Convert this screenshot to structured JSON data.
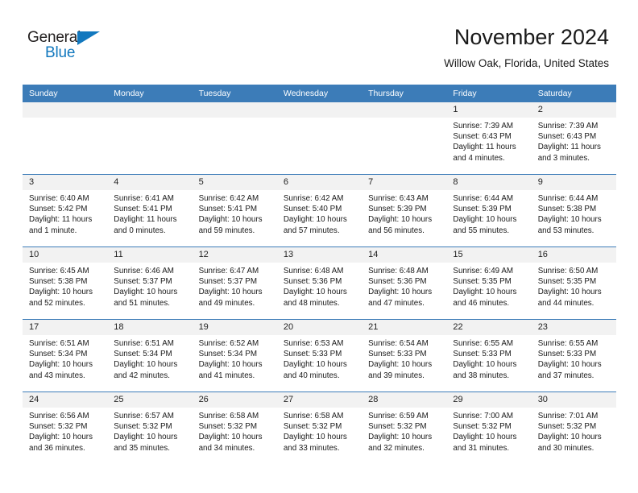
{
  "brand": {
    "name_part1": "General",
    "name_part2": "Blue",
    "accent_color": "#1278be",
    "logo_icon": "triangle-icon"
  },
  "header": {
    "title": "November 2024",
    "subtitle": "Willow Oak, Florida, United States"
  },
  "calendar": {
    "header_bg": "#3c7cb8",
    "daynum_bg": "#f2f2f2",
    "weekdays": [
      "Sunday",
      "Monday",
      "Tuesday",
      "Wednesday",
      "Thursday",
      "Friday",
      "Saturday"
    ],
    "weeks": [
      [
        {
          "day": "",
          "empty": true
        },
        {
          "day": "",
          "empty": true
        },
        {
          "day": "",
          "empty": true
        },
        {
          "day": "",
          "empty": true
        },
        {
          "day": "",
          "empty": true
        },
        {
          "day": "1",
          "sunrise": "Sunrise: 7:39 AM",
          "sunset": "Sunset: 6:43 PM",
          "daylight1": "Daylight: 11 hours",
          "daylight2": "and 4 minutes."
        },
        {
          "day": "2",
          "sunrise": "Sunrise: 7:39 AM",
          "sunset": "Sunset: 6:43 PM",
          "daylight1": "Daylight: 11 hours",
          "daylight2": "and 3 minutes."
        }
      ],
      [
        {
          "day": "3",
          "sunrise": "Sunrise: 6:40 AM",
          "sunset": "Sunset: 5:42 PM",
          "daylight1": "Daylight: 11 hours",
          "daylight2": "and 1 minute."
        },
        {
          "day": "4",
          "sunrise": "Sunrise: 6:41 AM",
          "sunset": "Sunset: 5:41 PM",
          "daylight1": "Daylight: 11 hours",
          "daylight2": "and 0 minutes."
        },
        {
          "day": "5",
          "sunrise": "Sunrise: 6:42 AM",
          "sunset": "Sunset: 5:41 PM",
          "daylight1": "Daylight: 10 hours",
          "daylight2": "and 59 minutes."
        },
        {
          "day": "6",
          "sunrise": "Sunrise: 6:42 AM",
          "sunset": "Sunset: 5:40 PM",
          "daylight1": "Daylight: 10 hours",
          "daylight2": "and 57 minutes."
        },
        {
          "day": "7",
          "sunrise": "Sunrise: 6:43 AM",
          "sunset": "Sunset: 5:39 PM",
          "daylight1": "Daylight: 10 hours",
          "daylight2": "and 56 minutes."
        },
        {
          "day": "8",
          "sunrise": "Sunrise: 6:44 AM",
          "sunset": "Sunset: 5:39 PM",
          "daylight1": "Daylight: 10 hours",
          "daylight2": "and 55 minutes."
        },
        {
          "day": "9",
          "sunrise": "Sunrise: 6:44 AM",
          "sunset": "Sunset: 5:38 PM",
          "daylight1": "Daylight: 10 hours",
          "daylight2": "and 53 minutes."
        }
      ],
      [
        {
          "day": "10",
          "sunrise": "Sunrise: 6:45 AM",
          "sunset": "Sunset: 5:38 PM",
          "daylight1": "Daylight: 10 hours",
          "daylight2": "and 52 minutes."
        },
        {
          "day": "11",
          "sunrise": "Sunrise: 6:46 AM",
          "sunset": "Sunset: 5:37 PM",
          "daylight1": "Daylight: 10 hours",
          "daylight2": "and 51 minutes."
        },
        {
          "day": "12",
          "sunrise": "Sunrise: 6:47 AM",
          "sunset": "Sunset: 5:37 PM",
          "daylight1": "Daylight: 10 hours",
          "daylight2": "and 49 minutes."
        },
        {
          "day": "13",
          "sunrise": "Sunrise: 6:48 AM",
          "sunset": "Sunset: 5:36 PM",
          "daylight1": "Daylight: 10 hours",
          "daylight2": "and 48 minutes."
        },
        {
          "day": "14",
          "sunrise": "Sunrise: 6:48 AM",
          "sunset": "Sunset: 5:36 PM",
          "daylight1": "Daylight: 10 hours",
          "daylight2": "and 47 minutes."
        },
        {
          "day": "15",
          "sunrise": "Sunrise: 6:49 AM",
          "sunset": "Sunset: 5:35 PM",
          "daylight1": "Daylight: 10 hours",
          "daylight2": "and 46 minutes."
        },
        {
          "day": "16",
          "sunrise": "Sunrise: 6:50 AM",
          "sunset": "Sunset: 5:35 PM",
          "daylight1": "Daylight: 10 hours",
          "daylight2": "and 44 minutes."
        }
      ],
      [
        {
          "day": "17",
          "sunrise": "Sunrise: 6:51 AM",
          "sunset": "Sunset: 5:34 PM",
          "daylight1": "Daylight: 10 hours",
          "daylight2": "and 43 minutes."
        },
        {
          "day": "18",
          "sunrise": "Sunrise: 6:51 AM",
          "sunset": "Sunset: 5:34 PM",
          "daylight1": "Daylight: 10 hours",
          "daylight2": "and 42 minutes."
        },
        {
          "day": "19",
          "sunrise": "Sunrise: 6:52 AM",
          "sunset": "Sunset: 5:34 PM",
          "daylight1": "Daylight: 10 hours",
          "daylight2": "and 41 minutes."
        },
        {
          "day": "20",
          "sunrise": "Sunrise: 6:53 AM",
          "sunset": "Sunset: 5:33 PM",
          "daylight1": "Daylight: 10 hours",
          "daylight2": "and 40 minutes."
        },
        {
          "day": "21",
          "sunrise": "Sunrise: 6:54 AM",
          "sunset": "Sunset: 5:33 PM",
          "daylight1": "Daylight: 10 hours",
          "daylight2": "and 39 minutes."
        },
        {
          "day": "22",
          "sunrise": "Sunrise: 6:55 AM",
          "sunset": "Sunset: 5:33 PM",
          "daylight1": "Daylight: 10 hours",
          "daylight2": "and 38 minutes."
        },
        {
          "day": "23",
          "sunrise": "Sunrise: 6:55 AM",
          "sunset": "Sunset: 5:33 PM",
          "daylight1": "Daylight: 10 hours",
          "daylight2": "and 37 minutes."
        }
      ],
      [
        {
          "day": "24",
          "sunrise": "Sunrise: 6:56 AM",
          "sunset": "Sunset: 5:32 PM",
          "daylight1": "Daylight: 10 hours",
          "daylight2": "and 36 minutes."
        },
        {
          "day": "25",
          "sunrise": "Sunrise: 6:57 AM",
          "sunset": "Sunset: 5:32 PM",
          "daylight1": "Daylight: 10 hours",
          "daylight2": "and 35 minutes."
        },
        {
          "day": "26",
          "sunrise": "Sunrise: 6:58 AM",
          "sunset": "Sunset: 5:32 PM",
          "daylight1": "Daylight: 10 hours",
          "daylight2": "and 34 minutes."
        },
        {
          "day": "27",
          "sunrise": "Sunrise: 6:58 AM",
          "sunset": "Sunset: 5:32 PM",
          "daylight1": "Daylight: 10 hours",
          "daylight2": "and 33 minutes."
        },
        {
          "day": "28",
          "sunrise": "Sunrise: 6:59 AM",
          "sunset": "Sunset: 5:32 PM",
          "daylight1": "Daylight: 10 hours",
          "daylight2": "and 32 minutes."
        },
        {
          "day": "29",
          "sunrise": "Sunrise: 7:00 AM",
          "sunset": "Sunset: 5:32 PM",
          "daylight1": "Daylight: 10 hours",
          "daylight2": "and 31 minutes."
        },
        {
          "day": "30",
          "sunrise": "Sunrise: 7:01 AM",
          "sunset": "Sunset: 5:32 PM",
          "daylight1": "Daylight: 10 hours",
          "daylight2": "and 30 minutes."
        }
      ]
    ]
  }
}
